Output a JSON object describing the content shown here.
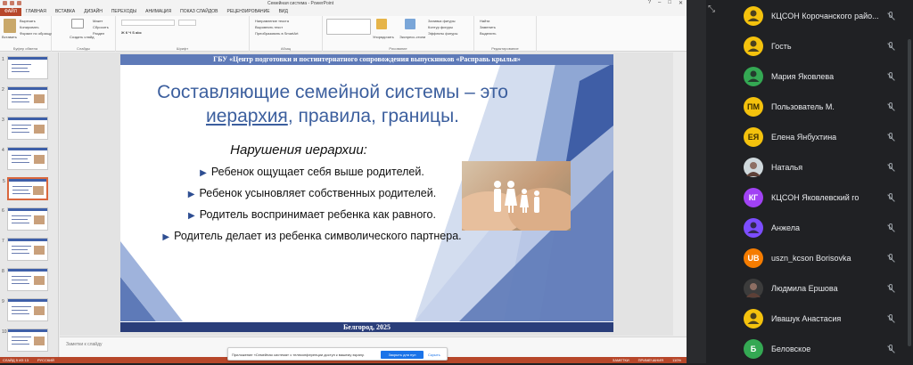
{
  "window": {
    "title": "Семейная система - PowerPoint"
  },
  "ribbon_tabs": [
    "ФАЙЛ",
    "ГЛАВНАЯ",
    "ВСТАВКА",
    "ДИЗАЙН",
    "ПЕРЕХОДЫ",
    "АНИМАЦИЯ",
    "ПОКАЗ СЛАЙДОВ",
    "РЕЦЕНЗИРОВАНИЕ",
    "ВИД"
  ],
  "ribbon": {
    "clipboard": {
      "label": "Буфер обмена",
      "paste": "Вставить",
      "cut": "Вырезать",
      "copy": "Копировать",
      "format": "Формат по образцу"
    },
    "slides": {
      "label": "Слайды",
      "new": "Создать слайд",
      "layout": "Макет",
      "reset": "Сбросить",
      "section": "Раздел"
    },
    "font": {
      "label": "Шрифт"
    },
    "paragraph": {
      "label": "Абзац",
      "dir": "Направление текста",
      "align": "Выровнять текст",
      "smart": "Преобразовать в SmartArt"
    },
    "drawing": {
      "label": "Рисование",
      "arrange": "Упорядочить",
      "styles": "Экспресс-стили",
      "fill": "Заливка фигуры",
      "outline": "Контур фигуры",
      "effects": "Эффекты фигуры"
    },
    "editing": {
      "label": "Редактирование",
      "find": "Найти",
      "replace": "Заменить",
      "select": "Выделить"
    }
  },
  "thumbnails": [
    "1",
    "2",
    "3",
    "4",
    "5",
    "6",
    "7",
    "8",
    "9",
    "10"
  ],
  "slide": {
    "banner": "ГБУ «Центр подготовки и постинтернатного сопровождения выпускников «Расправь крылья»",
    "title_line1": "Составляющие семейной системы – это",
    "title_link": "иерархия",
    "title_rest": ", правила, границы.",
    "subheading": "Нарушения иерархии:",
    "bullets": [
      "Ребенок ощущает себя выше родителей.",
      "Ребенок усыновляет собственных родителей.",
      "Родитель воспринимает ребенка как равного.",
      "Родитель делает из ребенка символического партнера."
    ],
    "footer": "Белгород, 2025"
  },
  "notes_placeholder": "Заметки к слайду",
  "status": {
    "slide": "СЛАЙД 5 ИЗ 13",
    "lang": "РУССКИЙ",
    "notes": "ЗАМЕТКИ",
    "comments": "ПРИМЕЧАНИЯ",
    "zoom": "110%"
  },
  "share_bar": {
    "message": "Приложение «Семейная система» с телеконференции доступ к вашему экрану.",
    "stop": "Закрыть для пул",
    "hide": "Скрыть"
  },
  "participants": [
    {
      "initials": "",
      "name": "КЦСОН Корочанского райо...",
      "color": "#f4c20d",
      "icon": "person-icon"
    },
    {
      "initials": "",
      "name": "Гость",
      "color": "#f4c20d",
      "icon": "person-icon"
    },
    {
      "initials": "",
      "name": "Мария Яковлева",
      "color": "#34a853",
      "icon": "person-icon"
    },
    {
      "initials": "ПМ",
      "name": "Пользователь М.",
      "color": "#f4c20d",
      "icon": ""
    },
    {
      "initials": "ЕЯ",
      "name": "Елена Янбухтина",
      "color": "#f4c20d",
      "icon": ""
    },
    {
      "initials": "",
      "name": "Наталья",
      "color": "#cfd8dc",
      "icon": "photo-avatar"
    },
    {
      "initials": "КГ",
      "name": "КЦСОН Яковлевский го",
      "color": "#a142f4",
      "icon": ""
    },
    {
      "initials": "",
      "name": "Анжела",
      "color": "#7c4dff",
      "icon": "person-icon"
    },
    {
      "initials": "UB",
      "name": "uszn_kcson Borisovka",
      "color": "#f57c00",
      "icon": ""
    },
    {
      "initials": "",
      "name": "Людмила Ершова",
      "color": "#3c3c3c",
      "icon": "photo-avatar"
    },
    {
      "initials": "",
      "name": "Ивашук Анастасия",
      "color": "#f4c20d",
      "icon": "person-icon"
    },
    {
      "initials": "Б",
      "name": "Беловское",
      "color": "#34a853",
      "icon": ""
    }
  ]
}
